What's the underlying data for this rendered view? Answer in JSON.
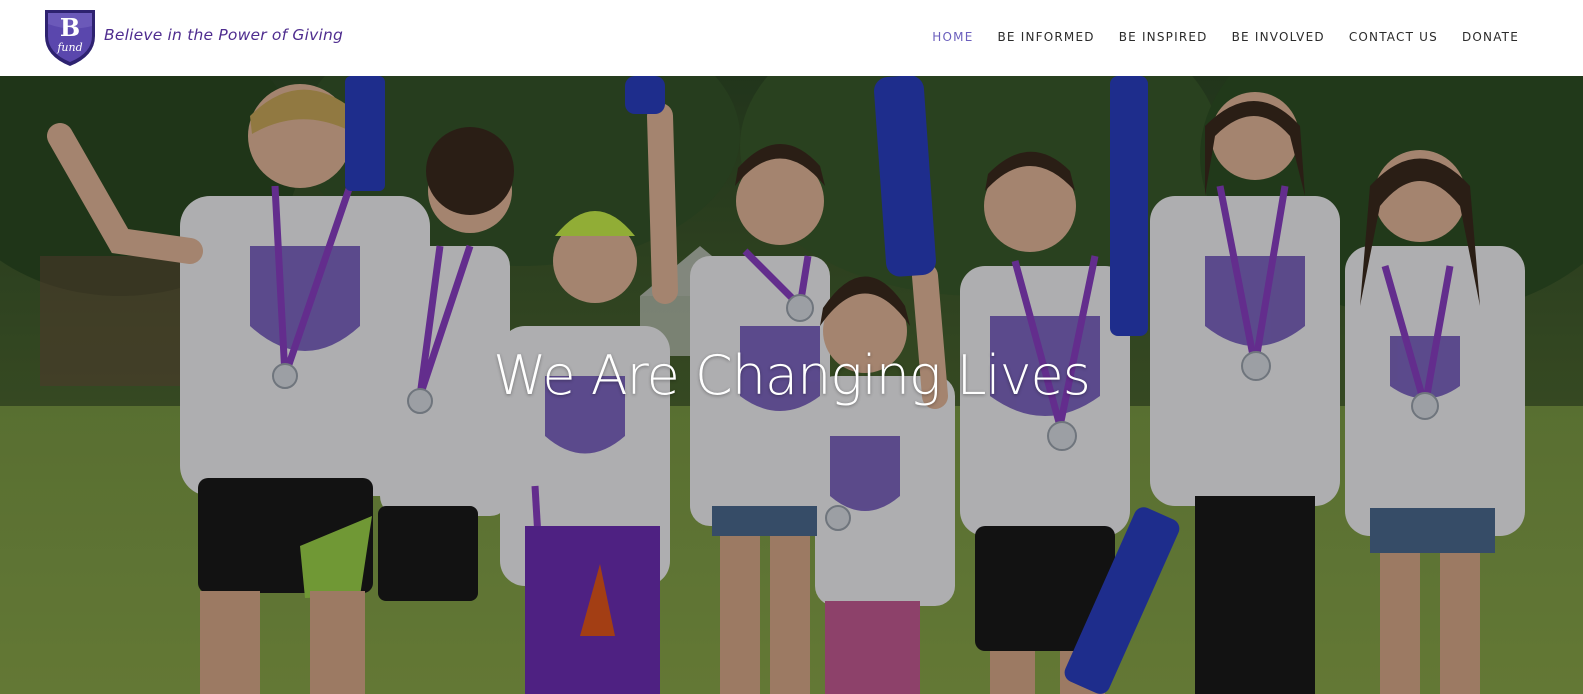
{
  "logo": {
    "letter": "B",
    "word": "fund",
    "tagline": "Believe in the Power of Giving",
    "colors": {
      "shield": "#4b3a9a",
      "shield_dark": "#2e2270",
      "tagline": "#4f2d8f"
    }
  },
  "nav": {
    "items": [
      {
        "label": "HOME",
        "active": true
      },
      {
        "label": "BE INFORMED",
        "active": false
      },
      {
        "label": "BE INSPIRED",
        "active": false
      },
      {
        "label": "BE INVOLVED",
        "active": false
      },
      {
        "label": "CONTACT US",
        "active": false
      },
      {
        "label": "DONATE",
        "active": false
      }
    ],
    "colors": {
      "active": "#6b5fbd",
      "default": "#2b2b2b"
    }
  },
  "hero": {
    "heading": "We Are Changing Lives",
    "image_subject": "children-in-bfund-shirts-with-medals",
    "colors": {
      "grass": "#6c8a3d",
      "shirt": "#f2f2f4",
      "lanyard": "#8a3fc4",
      "banner": "#2a3fc2"
    }
  }
}
